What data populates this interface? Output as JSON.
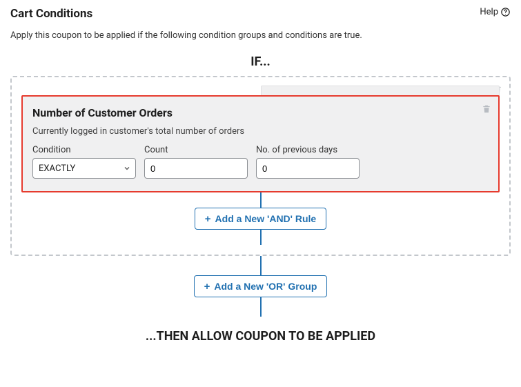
{
  "header": {
    "title": "Cart Conditions",
    "help": "Help"
  },
  "subtitle": "Apply this coupon to be applied if the following condition groups and conditions are true.",
  "if_label": "IF...",
  "then_label": "...THEN ALLOW COUPON TO BE APPLIED",
  "rule": {
    "title": "Number of Customer Orders",
    "description": "Currently logged in customer's total number of orders",
    "fields": {
      "condition": {
        "label": "Condition",
        "value": "EXACTLY"
      },
      "count": {
        "label": "Count",
        "value": "0"
      },
      "days": {
        "label": "No. of previous days",
        "value": "0"
      }
    }
  },
  "buttons": {
    "add_and": "Add a New 'AND' Rule",
    "add_or": "Add a New 'OR' Group"
  }
}
